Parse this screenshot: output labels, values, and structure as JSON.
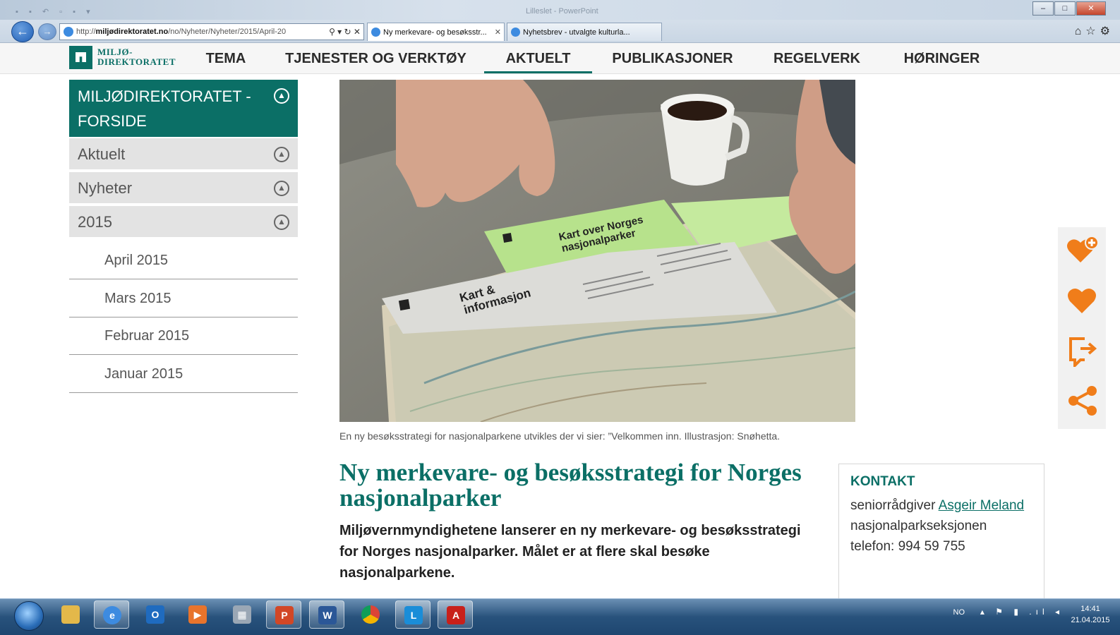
{
  "browser": {
    "address": "http://miljødirektoratet.no/no/Nyheter/Nyheter/2015/April-20",
    "address_host": "miljødirektoratet.no",
    "address_path": "/no/Nyheter/Nyheter/2015/April-20",
    "address_prefix": "http://",
    "window_title_faded": "Lilleslet - PowerPoint",
    "tabs": [
      {
        "label": "Ny merkevare- og besøksstr...",
        "active": true
      },
      {
        "label": "Nyhetsbrev - utvalgte kulturla...",
        "active": false
      }
    ]
  },
  "site": {
    "logo_line1": "MILJØ-",
    "logo_line2": "DIREKTORATET",
    "menu": [
      "TEMA",
      "TJENESTER OG VERKTØY",
      "AKTUELT",
      "PUBLIKASJONER",
      "REGELVERK",
      "HØRINGER"
    ],
    "active_menu": "AKTUELT"
  },
  "sidebar": {
    "home": "MILJØDIREKTORATET - FORSIDE",
    "levels": [
      "Aktuelt",
      "Nyheter",
      "2015"
    ],
    "months": [
      "April 2015",
      "Mars 2015",
      "Februar 2015",
      "Januar 2015"
    ]
  },
  "hero": {
    "map_title_1": "Kart over Norges",
    "map_title_2": "nasjonalparker",
    "map_sub_1": "Kart &",
    "map_sub_2": "informasjon"
  },
  "article": {
    "caption": "En ny besøksstrategi for nasjonalparkene utvikles der vi sier: ”Velkommen inn. Illustrasjon: Snøhetta.",
    "headline": "Ny merkevare- og besøksstrategi for Norges nasjonalparker",
    "lead": "Miljøvernmyndighetene lanserer en ny merkevare- og besøksstrategi for Norges nasjonalparker. Målet er at flere skal besøke nasjonalparkene."
  },
  "contact": {
    "heading": "KONTAKT",
    "role": "seniorrådgiver",
    "name": "Asgeir Meland",
    "section": "nasjonalparkseksjonen",
    "phone": "telefon: 994 59 755"
  },
  "rail": [
    "favorite-add-icon",
    "favorite-icon",
    "export-icon",
    "share-icon"
  ],
  "colors": {
    "brand": "#0b6f66",
    "accent": "#f07d1a"
  },
  "taskbar": {
    "language": "NO",
    "time": "14:41",
    "date": "21.04.2015",
    "apps": [
      "explorer",
      "internet-explorer",
      "outlook",
      "media-player",
      "calculator",
      "powerpoint",
      "word",
      "chrome",
      "lync",
      "acrobat"
    ]
  }
}
